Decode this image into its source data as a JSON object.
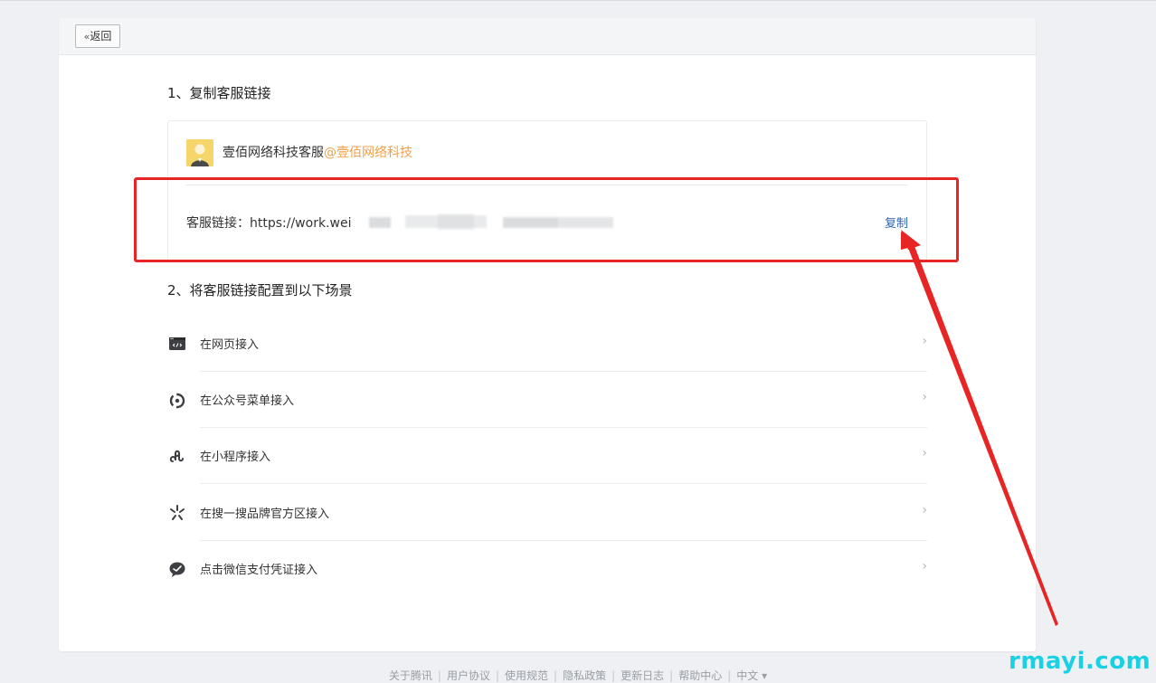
{
  "header": {
    "back_label": "返回"
  },
  "step1": {
    "title": "1、复制客服链接",
    "owner_name": "壹佰网络科技客服",
    "owner_corp": "@壹佰网络科技",
    "link_label": "客服链接：https://work.wei",
    "copy_label": "复制"
  },
  "step2": {
    "title": "2、将客服链接配置到以下场景",
    "items": [
      {
        "label": "在网页接入",
        "icon": "code-window-icon"
      },
      {
        "label": "在公众号菜单接入",
        "icon": "official-account-icon"
      },
      {
        "label": "在小程序接入",
        "icon": "mini-program-icon"
      },
      {
        "label": "在搜一搜品牌官方区接入",
        "icon": "search-sparkle-icon"
      },
      {
        "label": "点击微信支付凭证接入",
        "icon": "chat-bubble-icon"
      }
    ]
  },
  "footer": {
    "links": [
      "关于腾讯",
      "用户协议",
      "使用规范",
      "隐私政策",
      "更新日志",
      "帮助中心",
      "中文 ▾"
    ]
  },
  "watermark": "rmayi.com",
  "colors": {
    "accent_orange": "#f0a048",
    "link_blue": "#2d66b3",
    "annotation_red": "#e82525",
    "watermark_cyan": "#19d1e3"
  }
}
